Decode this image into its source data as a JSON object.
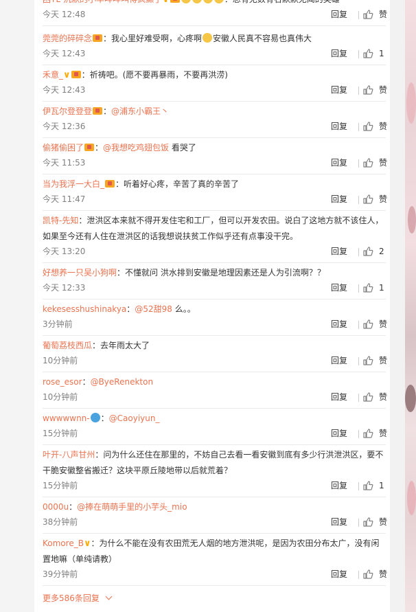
{
  "labels": {
    "reply": "回复",
    "like_placeholder": "赞",
    "more": "更多586条回复"
  },
  "comments": [
    {
      "user": "困TL-沉默的小羊咩咩叫得疯癫了",
      "badges": [
        "vip",
        "badge",
        "emoji",
        "emoji",
        "emoji",
        "emoji"
      ],
      "text": "总有无数有名默默无闻的英雄",
      "time": "今天 12:48",
      "likes": ""
    },
    {
      "user": "莞莞的碎碎念",
      "badges": [
        "badge"
      ],
      "text": "我心里好难受啊，心疼啊",
      "text_emoji": "emoji",
      "text2": "安徽人民真不容易也真伟大",
      "time": "今天 12:43",
      "likes": "1"
    },
    {
      "user": "禾意_",
      "badges": [
        "vip",
        "badge"
      ],
      "text": "祈祷吧。(愿不要再暴雨，不要再洪涝)",
      "time": "今天 12:43",
      "likes": ""
    },
    {
      "user": "伊瓦尔登登登",
      "badges": [
        "badge"
      ],
      "mention": "@浦东小霸王丶",
      "text": "",
      "time": "今天 12:36",
      "likes": ""
    },
    {
      "user": "偷猪偷困了",
      "badges": [
        "badge"
      ],
      "mention": "@我想吃鸡翅包饭",
      "text": "看哭了",
      "time": "今天 11:53",
      "likes": ""
    },
    {
      "user": "当为我浮一大白_",
      "badges": [
        "badge"
      ],
      "text": "听着好心疼，辛苦了真的辛苦了",
      "time": "今天 11:47",
      "likes": ""
    },
    {
      "user": "凯特-先知",
      "badges": [],
      "text": "泄洪区本来就不得开发住宅和工厂，但可以开发农田。说白了这地方就不该住人，如果至今还有人住在泄洪区的话我想说扶贫工作似乎还有点事没干完。",
      "time": "今天 13:20",
      "likes": "2"
    },
    {
      "user": "好想养一只吴小狗啊",
      "badges": [],
      "text": "不懂就问 洪水排到安徽是地理因素还是人为引流啊？？",
      "time": "今天 12:33",
      "likes": "1"
    },
    {
      "user": "kekesesshushinakya",
      "badges": [],
      "mention": "@52甜98",
      "text": "么。。",
      "time": "3分钟前",
      "likes": ""
    },
    {
      "user": "葡萄荔枝西瓜",
      "badges": [],
      "text": "去年雨太大了",
      "time": "10分钟前",
      "likes": ""
    },
    {
      "user": "rose_esor",
      "badges": [],
      "mention": "@ByeRenekton",
      "text": "",
      "time": "10分钟前",
      "likes": ""
    },
    {
      "user": "wwwwwnn-",
      "badges": [
        "emoji-blue"
      ],
      "mention": "@Caoyiyun_",
      "text": "",
      "time": "15分钟前",
      "likes": ""
    },
    {
      "user": "叶开-八声甘州",
      "badges": [],
      "text": "问为什么还住在那里的，不妨自己去看一看安徽到底有多少行洪泄洪区，要不干脆安徽整省搬迁？这块平原丘陵地带以后就荒着？",
      "time": "15分钟前",
      "likes": "1"
    },
    {
      "user": "0000u",
      "badges": [],
      "mention": "@捧在萌萌手里的小芋头_mio",
      "text": "",
      "time": "38分钟前",
      "likes": ""
    },
    {
      "user": "Komore_B",
      "badges": [
        "vip"
      ],
      "text": "为什么不能在没有农田荒无人烟的地方泄洪呢，是因为农田分布太广，没有闲置地嘛（单纯请教）",
      "time": "39分钟前",
      "likes": ""
    }
  ]
}
